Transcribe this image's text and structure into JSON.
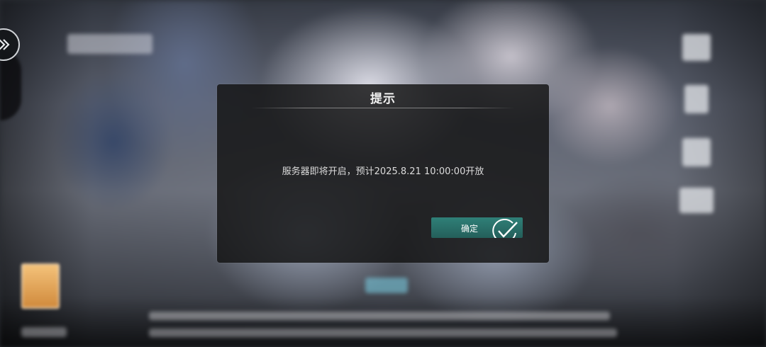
{
  "dialog": {
    "title": "提示",
    "message": "服务器即将开启，预计2025.8.21 10:00:00开放",
    "confirm_label": "确定"
  },
  "icons": {
    "left_button": "double-chevron-right-icon",
    "confirm": "checkmark-circle-icon"
  },
  "colors": {
    "dialog_bg": "#121212",
    "confirm_button": "#2b7069",
    "text": "#dcdcdc"
  }
}
